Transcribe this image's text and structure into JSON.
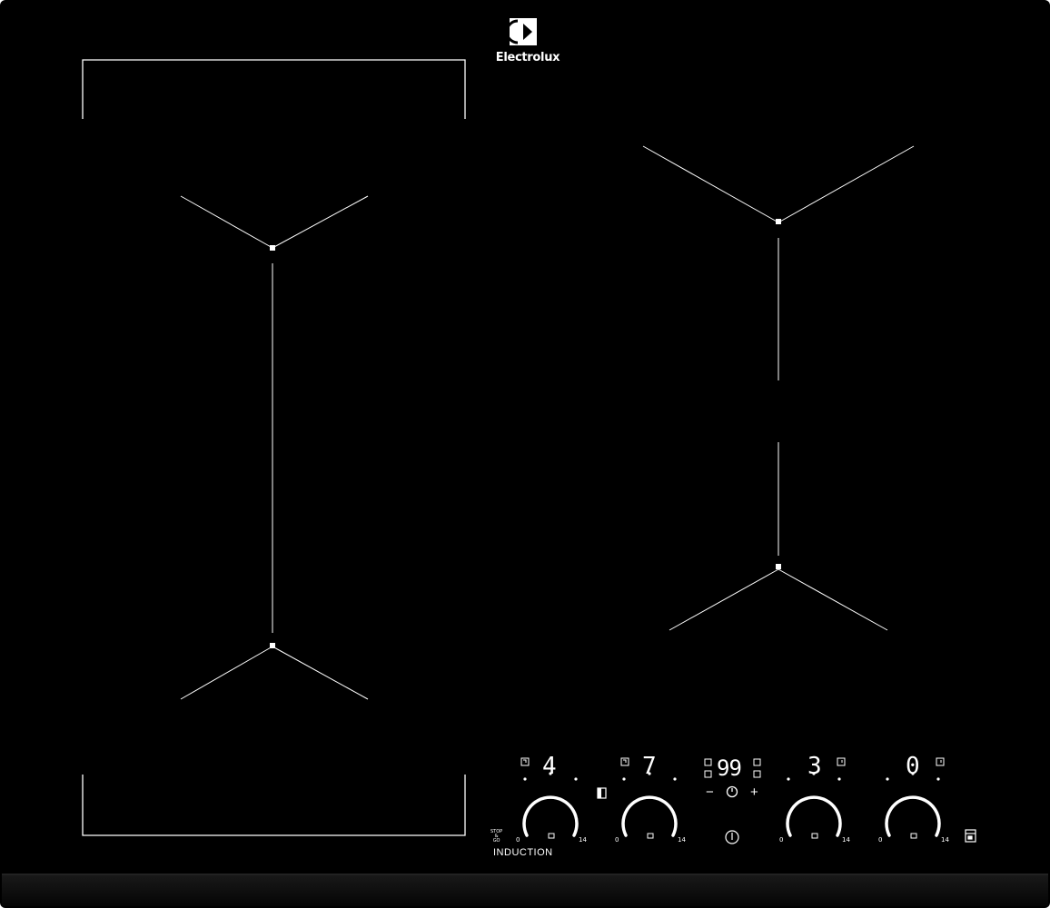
{
  "brand": {
    "name": "Electrolux",
    "logo_icon": "electrolux-logo-icon"
  },
  "panel": {
    "label": "INDUCTION",
    "stop_go_label": "STOP\n&\nGO"
  },
  "zones": [
    {
      "id": "zone-1",
      "display": "4",
      "scale_min": "0",
      "scale_max": "14"
    },
    {
      "id": "zone-2",
      "display": "7",
      "scale_min": "0",
      "scale_max": "14"
    },
    {
      "id": "zone-3",
      "display": "3",
      "scale_min": "0",
      "scale_max": "14"
    },
    {
      "id": "zone-4",
      "display": "0",
      "scale_min": "0",
      "scale_max": "14"
    }
  ],
  "timer": {
    "display": "99",
    "minus": "−",
    "plus": "+"
  },
  "colors": {
    "glass": "#000000",
    "print": "#ffffff",
    "bevel": "#141414"
  },
  "icons": [
    "power-icon",
    "clock-icon",
    "bridge-icon",
    "lock-icon",
    "booster-icon",
    "hob2hood-icon"
  ]
}
